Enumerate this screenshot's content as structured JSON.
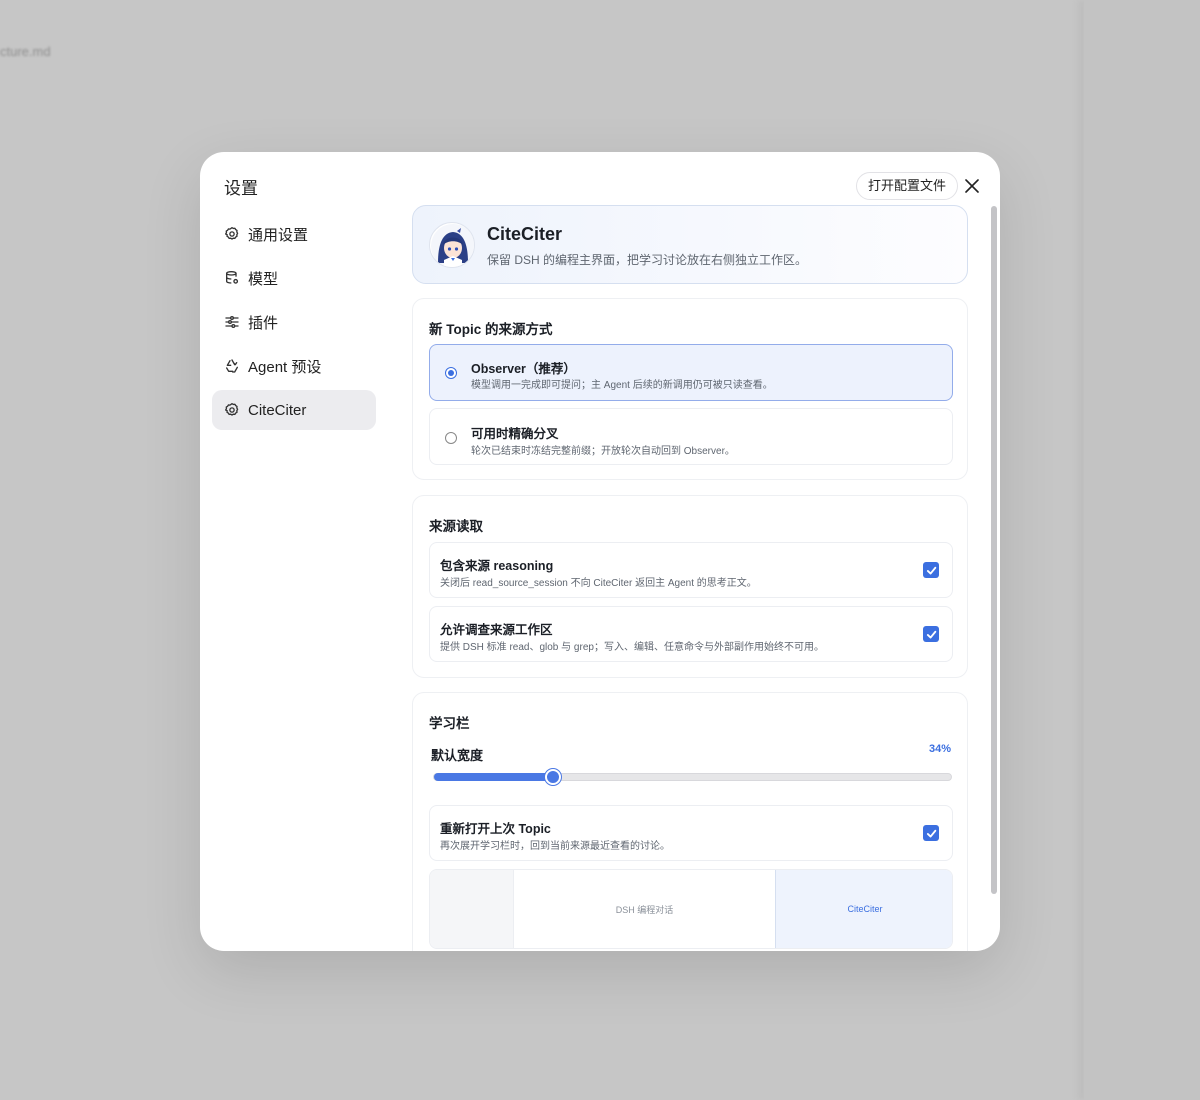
{
  "background": {
    "file_name": "cture.md"
  },
  "modal": {
    "title": "设置",
    "open_config_label": "打开配置文件"
  },
  "nav": {
    "items": [
      {
        "label": "通用设置",
        "icon": "gear-icon"
      },
      {
        "label": "模型",
        "icon": "database-icon"
      },
      {
        "label": "插件",
        "icon": "sliders-icon"
      },
      {
        "label": "Agent 预设",
        "icon": "recycle-icon"
      },
      {
        "label": "CiteCiter",
        "icon": "gear-icon",
        "active": true
      }
    ]
  },
  "hero": {
    "name": "CiteCiter",
    "subtitle": "保留 DSH 的编程主界面，把学习讨论放在右侧独立工作区。"
  },
  "topic_source": {
    "title": "新 Topic 的来源方式",
    "options": [
      {
        "title": "Observer（推荐）",
        "desc": "模型调用一完成即可提问；主 Agent 后续的新调用仍可被只读查看。",
        "selected": true
      },
      {
        "title": "可用时精确分叉",
        "desc": "轮次已结束时冻结完整前缀；开放轮次自动回到 Observer。",
        "selected": false
      }
    ]
  },
  "source_read": {
    "title": "来源读取",
    "rows": [
      {
        "title": "包含来源 reasoning",
        "desc": "关闭后 read_source_session 不向 CiteCiter 返回主 Agent 的思考正文。",
        "checked": true
      },
      {
        "title": "允许调查来源工作区",
        "desc": "提供 DSH 标准 read、glob 与 grep；写入、编辑、任意命令与外部副作用始终不可用。",
        "checked": true
      }
    ]
  },
  "study_bar": {
    "title": "学习栏",
    "width_label": "默认宽度",
    "width_value_text": "34%",
    "width_fraction": 0.23,
    "reopen": {
      "title": "重新打开上次 Topic",
      "desc": "再次展开学习栏时，回到当前来源最近查看的讨论。",
      "checked": true
    },
    "preview": {
      "main_label": "DSH 编程对话",
      "side_label": "CiteCiter"
    }
  },
  "colors": {
    "accent": "#3b6fe0",
    "selected_bg": "#edf2fd",
    "nav_active_bg": "#ececef"
  }
}
